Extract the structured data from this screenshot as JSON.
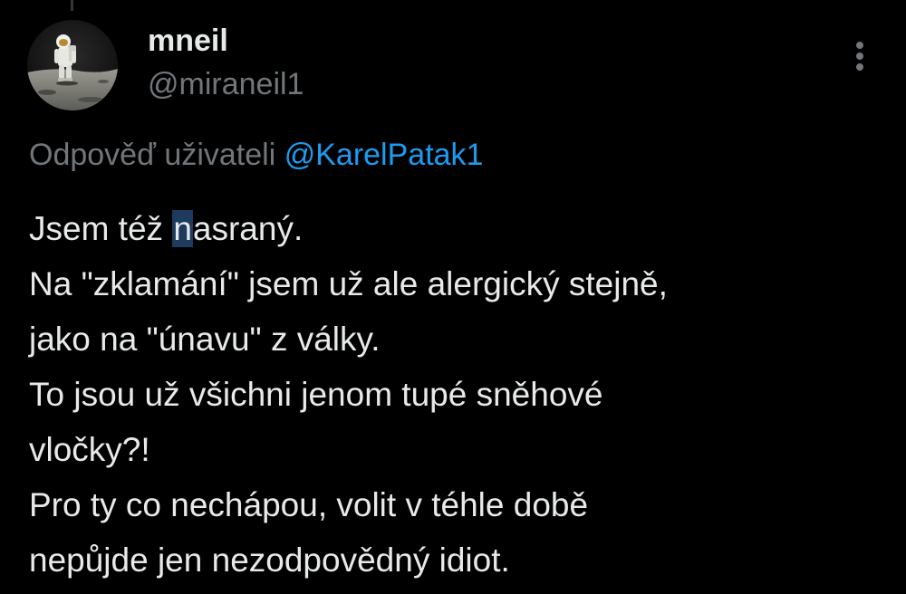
{
  "author": {
    "display_name": "mneil",
    "handle": "@miraneil1",
    "avatar_icon": "astronaut-moon-avatar"
  },
  "menu": {
    "icon": "more-vertical-icon"
  },
  "reply_to": {
    "prefix": "Odpověď uživateli",
    "mention": "@KarelPatak1"
  },
  "tweet": {
    "line1_before": "Jsem též ",
    "line1_highlight": "n",
    "line1_after": "asraný.",
    "lines": [
      "Na \"zklamání\" jsem už ale alergický stejně,",
      "jako na \"únavu\" z války.",
      "To jsou už všichni jenom tupé sněhové",
      "vločky?!",
      "Pro ty co nechápou, volit v téhle době",
      "nepůjde jen nezodpovědný idiot."
    ]
  },
  "colors": {
    "background": "#000000",
    "primary_text": "#e7e9ea",
    "secondary_text": "#71767b",
    "link": "#1d9bf0"
  }
}
